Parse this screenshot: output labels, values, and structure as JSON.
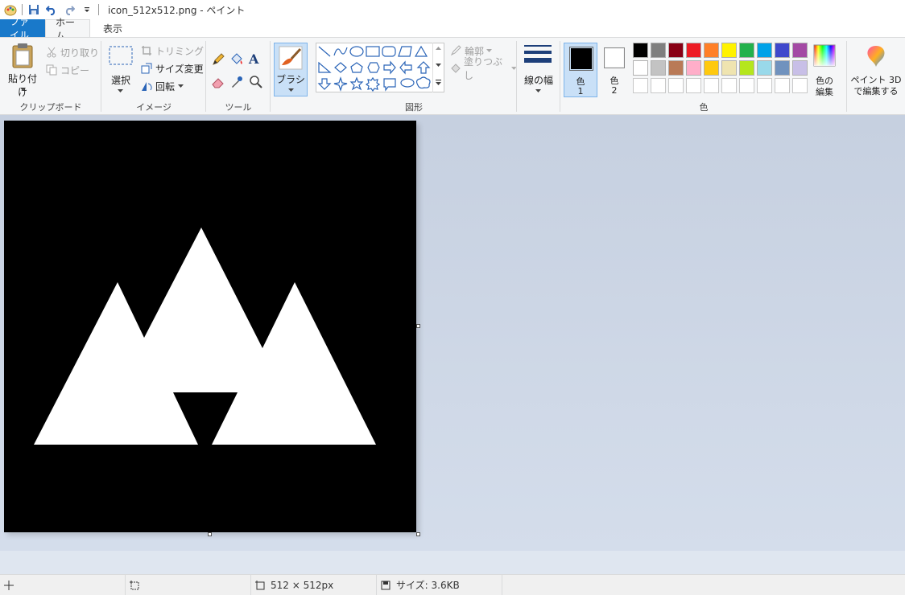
{
  "window": {
    "title": "icon_512x512.png - ペイント"
  },
  "tabs": {
    "file": "ファイル",
    "home": "ホーム",
    "view": "表示"
  },
  "ribbon": {
    "clipboard": {
      "label": "クリップボード",
      "paste": "貼り付け",
      "cut": "切り取り",
      "copy": "コピー"
    },
    "image": {
      "label": "イメージ",
      "select": "選択",
      "crop": "トリミング",
      "resize": "サイズ変更",
      "rotate": "回転"
    },
    "tools": {
      "label": "ツール"
    },
    "brushes": {
      "label": "ブラシ"
    },
    "shapes": {
      "label": "図形",
      "outline": "輪郭",
      "fill": "塗りつぶし"
    },
    "size": {
      "label": "線の幅"
    },
    "colors": {
      "label": "色",
      "color1": {
        "line1": "色",
        "line2": "1",
        "value": "#000000"
      },
      "color2": {
        "line1": "色",
        "line2": "2",
        "value": "#ffffff"
      },
      "edit_line1": "色の",
      "edit_line2": "編集",
      "palette_row1": [
        "#000000",
        "#7f7f7f",
        "#880015",
        "#ed1c24",
        "#ff7f27",
        "#fff200",
        "#22b14c",
        "#00a2e8",
        "#3f48cc",
        "#a349a4"
      ],
      "palette_row2": [
        "#ffffff",
        "#c3c3c3",
        "#b97a57",
        "#ffaec9",
        "#ffc90e",
        "#efe4b0",
        "#b5e61d",
        "#99d9ea",
        "#7092be",
        "#c8bfe7"
      ]
    },
    "paint3d": {
      "line1": "ペイント 3D",
      "line2": "で編集する"
    }
  },
  "status": {
    "dimensions": "512 × 512px",
    "size": "サイズ: 3.6KB"
  },
  "colors": {
    "accent": "#1979ca",
    "workspace": "#c6d0e0",
    "canvas": "#000000"
  }
}
